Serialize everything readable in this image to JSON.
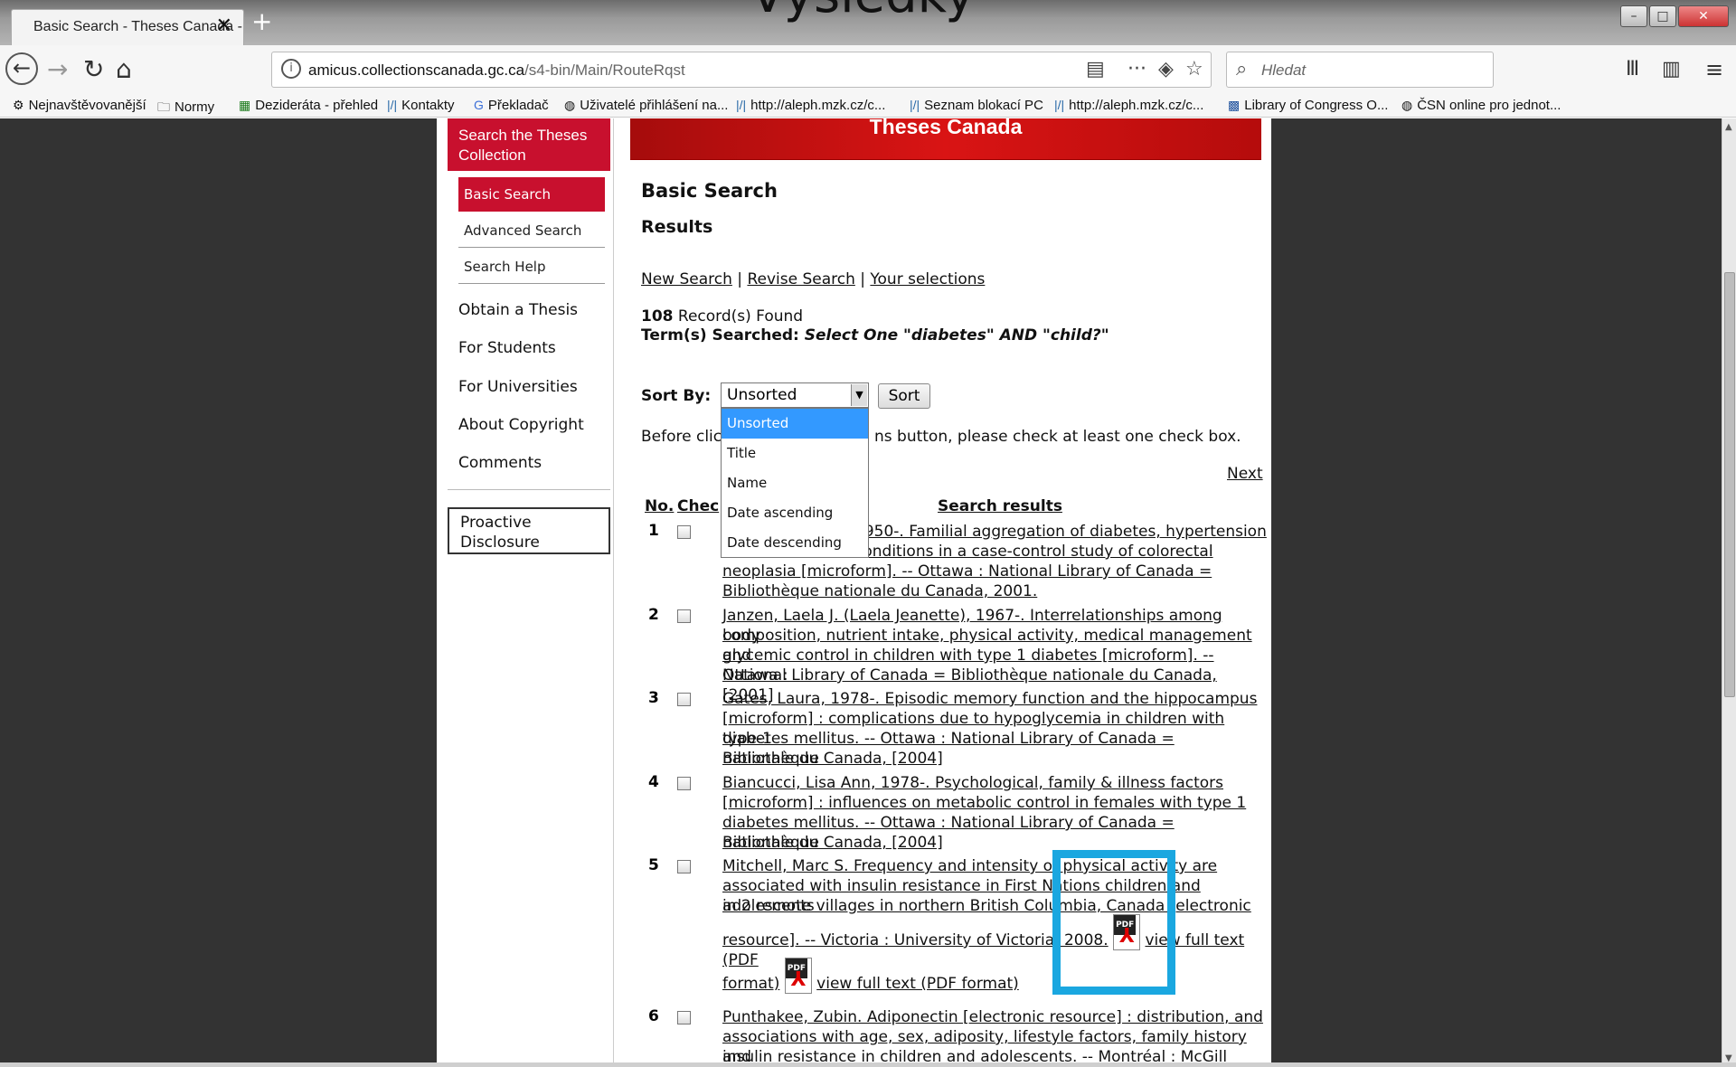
{
  "browser": {
    "overlay_title": "Výsledky",
    "tab_title": "Basic Search - Theses Canada -",
    "new_tab": "+",
    "url_domain": "amicus.collectionscanada.gc.ca",
    "url_path": "/s4-bin/Main/RouteRqst",
    "search_placeholder": "Hledat",
    "bookmarks": [
      "Nejnavštěvovanější",
      "Normy",
      "Dezideráta - přehled",
      "Kontakty",
      "Překladač",
      "Uživatelé přihlášení na...",
      "http://aleph.mzk.cz/c...",
      "Seznam blokací PC",
      "http://aleph.mzk.cz/c...",
      "Library of Congress O...",
      "ČSN online pro jednot..."
    ]
  },
  "sidebar": {
    "header": "Search the Theses Collection",
    "basic_search": "Basic Search",
    "advanced_search": "Advanced Search",
    "search_help": "Search Help",
    "items": [
      "Obtain a Thesis",
      "For Students",
      "For Universities",
      "About Copyright",
      "Comments"
    ],
    "proactive": "Proactive Disclosure"
  },
  "banner": "Theses Canada",
  "main": {
    "title": "Basic Search",
    "subtitle": "Results",
    "links": [
      "New Search",
      "Revise Search",
      "Your selections"
    ],
    "count": "108",
    "count_suffix": "Record(s) Found",
    "terms_label": "Term(s) Searched:",
    "terms_value": "Select One \"diabetes\" AND \"child?\"",
    "sort_label": "Sort By:",
    "sort_value": "Unsorted",
    "sort_button": "Sort",
    "sort_options": [
      "Unsorted",
      "Title",
      "Name",
      "Date ascending",
      "Date descending"
    ],
    "before_text_a": "Before clic",
    "before_text_b": "ns button, please check at least one check box.",
    "next": "Next",
    "col_no": "No.",
    "col_check": "Chec",
    "col_results": "Search results",
    "pdf_label": "PDF",
    "records": [
      {
        "no": "1",
        "lines": [
          "1950-. Familial aggregation of diabetes, hypertension",
          "conditions in a case-control study of colorectal",
          "neoplasia [microform]. -- Ottawa : National Library of Canada =",
          "Bibliothèque nationale du Canada, 2001."
        ]
      },
      {
        "no": "2",
        "lines": [
          "Janzen, Laela J. (Laela Jeanette), 1967-. Interrelationships among body",
          "composition, nutrient intake, physical activity, medical management and",
          "glycemic control in children with type 1 diabetes [microform]. -- Ottawa :",
          "National Library of Canada = Bibliothèque nationale du Canada, [2001]"
        ]
      },
      {
        "no": "3",
        "lines": [
          "Gates, Laura, 1978-. Episodic memory function and the hippocampus",
          "[microform] : complications due to hypoglycemia in children with type-1",
          "diabetes mellitus. -- Ottawa : National Library of Canada = Bibliothèque",
          "nationale du Canada, [2004]"
        ]
      },
      {
        "no": "4",
        "lines": [
          "Biancucci, Lisa Ann, 1978-. Psychological, family & illness factors",
          "[microform] : influences on metabolic control in females with type 1",
          "diabetes mellitus. -- Ottawa : National Library of Canada = Bibliothèque",
          "nationale du Canada, [2004]"
        ]
      },
      {
        "no": "5",
        "lines": [
          "Mitchell, Marc S. Frequency and intensity of physical activity are",
          "associated with insulin resistance in First Nations children and adolescents",
          "in 2 remote villages in northern British Columbia, Canada [electronic"
        ],
        "line4": "resource]. -- Victoria : University of Victoria, 2008.",
        "pdf1": "view full text (PDF",
        "line5": "format)",
        "pdf2": "view full text (PDF format)"
      },
      {
        "no": "6",
        "lines": [
          "Punthakee, Zubin. Adiponectin [electronic resource] : distribution, and",
          "associations with age, sex, adiposity, lifestyle factors, family history and",
          "insulin resistance in children and adolescents. -- Montréal : McGill"
        ]
      }
    ]
  },
  "colors": {
    "accent_red": "#c8102e",
    "highlight_blue": "#1aa7e0",
    "select_blue": "#3399ff"
  }
}
